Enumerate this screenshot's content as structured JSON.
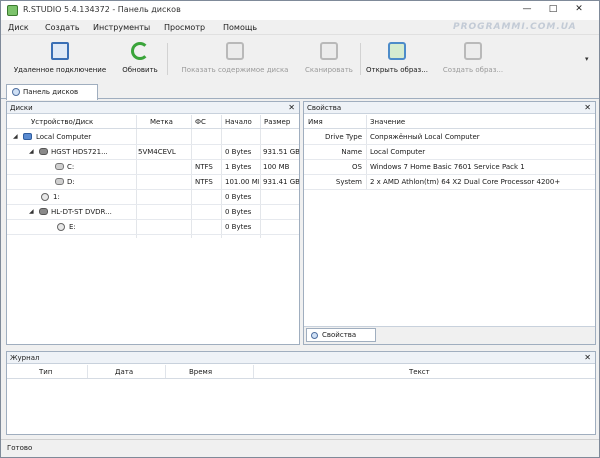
{
  "window": {
    "title": "R.STUDIO 5.4.134372 - Панель дисков",
    "minimize": "—",
    "maximize": "□",
    "close": "✕"
  },
  "menu": [
    "Диск",
    "Создать",
    "Инструменты",
    "Просмотр",
    "Помощь"
  ],
  "watermark": "PROGRAMMI.COM.UA",
  "toolbar": {
    "buttons": [
      {
        "label": "Удаленное подключение",
        "icon": "remote-connection-icon",
        "enabled": true
      },
      {
        "label": "Обновить",
        "icon": "refresh-icon",
        "enabled": true
      },
      {
        "label": "Показать содержимое диска",
        "icon": "show-contents-icon",
        "enabled": false
      },
      {
        "label": "Сканировать",
        "icon": "scan-icon",
        "enabled": false
      },
      {
        "label": "Открыть образ...",
        "icon": "open-image-icon",
        "enabled": true
      },
      {
        "label": "Создать образ...",
        "icon": "create-image-icon",
        "enabled": false
      }
    ],
    "more": "▾"
  },
  "tabs": {
    "disk_panel": "Панель дисков"
  },
  "disks_panel": {
    "title": "Диски",
    "close": "✕",
    "columns": [
      "Устройство/Диск",
      "Метка",
      "ФС",
      "Начало",
      "Размер"
    ],
    "rows": [
      {
        "expander": "◢",
        "name": "Local Computer",
        "label": "",
        "fs": "",
        "start": "",
        "size": ""
      },
      {
        "expander": "◢",
        "name": "HGST HDS721...",
        "label": "5VM4CEVL",
        "fs": "",
        "start": "0 Bytes",
        "size": "931.51 GB"
      },
      {
        "expander": "",
        "name": "C:",
        "label": "",
        "fs": "NTFS",
        "start": "1 Bytes",
        "size": "100 MB"
      },
      {
        "expander": "",
        "name": "D:",
        "label": "",
        "fs": "NTFS",
        "start": "101.00 MB",
        "size": "931.41 GB"
      },
      {
        "expander": "",
        "name": "1:",
        "label": "",
        "fs": "",
        "start": "0 Bytes",
        "size": ""
      },
      {
        "expander": "◢",
        "name": "HL-DT-ST DVDR...",
        "label": "",
        "fs": "",
        "start": "0 Bytes",
        "size": ""
      },
      {
        "expander": "",
        "name": "E:",
        "label": "",
        "fs": "",
        "start": "0 Bytes",
        "size": ""
      }
    ]
  },
  "props_panel": {
    "title": "Свойства",
    "close": "✕",
    "columns": [
      "Имя",
      "Значение"
    ],
    "rows": [
      {
        "name": "Drive Type",
        "value": "Сопряжённый Local Computer"
      },
      {
        "name": "Name",
        "value": "Local Computer"
      },
      {
        "name": "OS",
        "value": "Windows 7 Home Basic 7601 Service Pack 1"
      },
      {
        "name": "System",
        "value": "2 x AMD Athlon(tm) 64 X2 Dual Core Processor 4200+"
      }
    ],
    "tab": "Свойства"
  },
  "journal": {
    "title": "Журнал",
    "close": "✕",
    "columns": [
      "Тип",
      "Дата",
      "Время",
      "Текст"
    ]
  },
  "status": "Готово"
}
